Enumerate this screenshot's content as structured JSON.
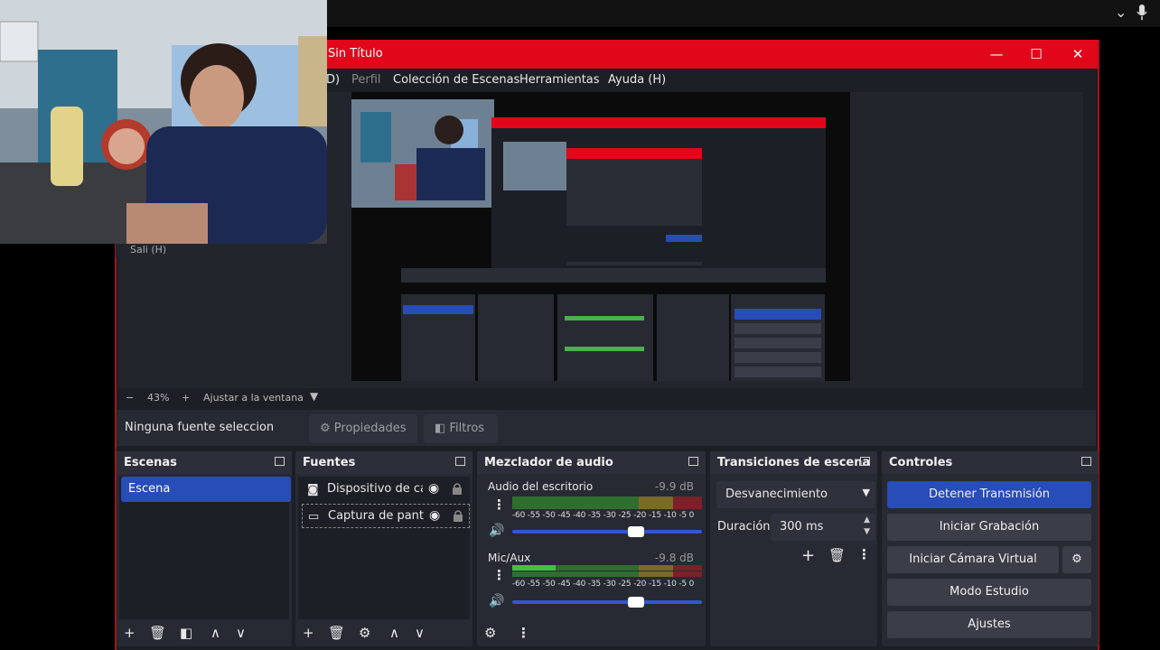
{
  "window": {
    "title": "Sin Título"
  },
  "menu": {
    "items_visible": [
      "D)",
      "Perfil",
      "Colección de Escenas",
      "Herramientas",
      "Ayuda (H)"
    ]
  },
  "zoom": {
    "minus": "−",
    "level": "43%",
    "plus": "+",
    "fit": "Ajustar a la ventana"
  },
  "source_toolbar": {
    "selection": "Ninguna fuente seleccionada",
    "properties": "Propiedades",
    "filters": "Filtros"
  },
  "scenes": {
    "title": "Escenas",
    "items": [
      "Escena"
    ]
  },
  "sources": {
    "title": "Fuentes",
    "items": [
      "Dispositivo de captura de video",
      "Captura de pantalla"
    ]
  },
  "mixer": {
    "title": "Mezclador de audio",
    "ticks": "-60 -55 -50 -45 -40 -35 -30 -25 -20 -15 -10 -5 0",
    "channels": [
      {
        "name": "Audio del escritorio",
        "db": "-9.9 dB",
        "volume_fraction": 0.65
      },
      {
        "name": "Mic/Aux",
        "db": "-9.8 dB",
        "volume_fraction": 0.65
      }
    ]
  },
  "transitions": {
    "title": "Transiciones de escena",
    "selected": "Desvanecimiento",
    "duration_label": "Duración",
    "duration_value": "300 ms"
  },
  "controls": {
    "title": "Controles",
    "stop_stream": "Detener Transmisión",
    "start_recording": "Iniciar Grabación",
    "virtual_cam": "Iniciar Cámara Virtual",
    "studio_mode": "Modo Estudio",
    "settings": "Ajustes"
  },
  "webcam": {
    "caption": "Sali (H)"
  },
  "colors": {
    "accent_blue": "#284cb8",
    "title_red": "#e2061b",
    "bg": "#1d1f26"
  }
}
